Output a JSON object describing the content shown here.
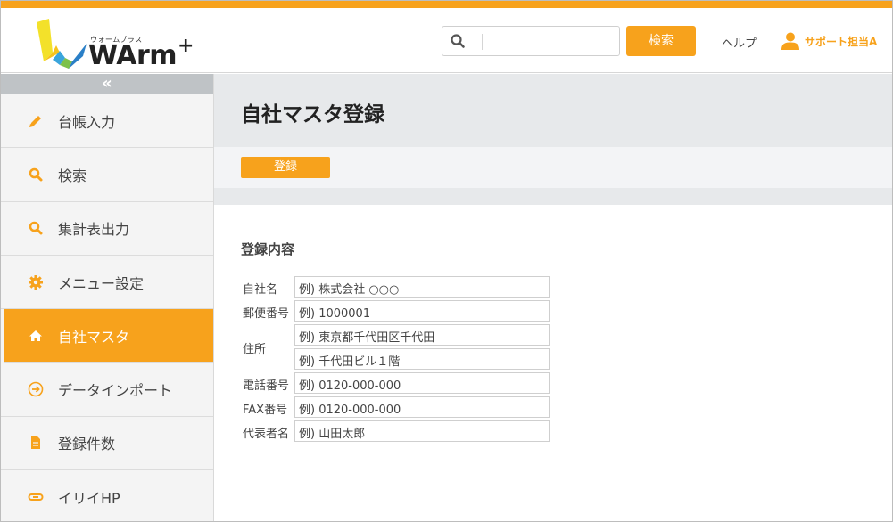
{
  "header": {
    "logo_ruby": "ウォームプラス",
    "logo_text": "WArm",
    "logo_plus": "+",
    "search_placeholder": "",
    "search_button": "検索",
    "help": "ヘルプ",
    "user_name": "サポート担当A"
  },
  "sidebar": {
    "collapse": "«",
    "items": [
      {
        "label": "台帳入力",
        "icon": "pencil-icon"
      },
      {
        "label": "検索",
        "icon": "search-icon"
      },
      {
        "label": "集計表出力",
        "icon": "search-icon"
      },
      {
        "label": "メニュー設定",
        "icon": "gear-icon"
      },
      {
        "label": "自社マスタ",
        "icon": "home-icon",
        "active": true
      },
      {
        "label": "データインポート",
        "icon": "import-icon"
      },
      {
        "label": "登録件数",
        "icon": "document-icon"
      },
      {
        "label": "イリイHP",
        "icon": "link-icon"
      }
    ]
  },
  "main": {
    "title": "自社マスタ登録",
    "register_button": "登録",
    "section_title": "登録内容",
    "form": {
      "company_label": "自社名",
      "company_value": "例) 株式会社 ○○○",
      "postal_label": "郵便番号",
      "postal_value": "例) 1000001",
      "address_label": "住所",
      "address1_value": "例) 東京都千代田区千代田",
      "address2_value": "例) 千代田ビル１階",
      "phone_label": "電話番号",
      "phone_value": "例) 0120-000-000",
      "fax_label": "FAX番号",
      "fax_value": "例) 0120-000-000",
      "rep_label": "代表者名",
      "rep_value": "例) 山田太郎"
    }
  },
  "colors": {
    "accent": "#f7a21c",
    "band": "#e7e9eb",
    "sidebar_bg": "#f4f4f4"
  }
}
